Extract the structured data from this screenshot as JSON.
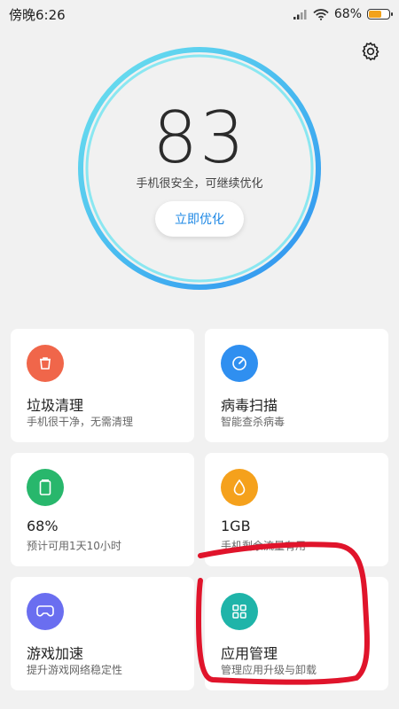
{
  "status_bar": {
    "time": "傍晚6:26",
    "battery_percent": "68%",
    "battery_level": 0.68
  },
  "score": {
    "value": "83",
    "status": "手机很安全，可继续优化",
    "optimize_label": "立即优化"
  },
  "tiles": [
    {
      "title": "垃圾清理",
      "subtitle": "手机很干净，无需清理",
      "icon": "trash-icon",
      "color": "#f0664a"
    },
    {
      "title": "病毒扫描",
      "subtitle": "智能查杀病毒",
      "icon": "scan-gauge-icon",
      "color": "#2f8ff0"
    },
    {
      "title": "68%",
      "subtitle": "预计可用1天10小时",
      "icon": "battery-icon",
      "color": "#28b76c"
    },
    {
      "title": "1GB",
      "subtitle": "手机剩余流量有用",
      "icon": "droplet-icon",
      "color": "#f5a11c"
    },
    {
      "title": "游戏加速",
      "subtitle": "提升游戏网络稳定性",
      "icon": "gamepad-icon",
      "color": "#6a6ef0"
    },
    {
      "title": "应用管理",
      "subtitle": "管理应用升级与卸载",
      "icon": "grid-icon",
      "color": "#1fb4a9"
    }
  ],
  "colors": {
    "ring_outer": "#3aa6ee",
    "ring_inner": "#66dff0",
    "annotation": "#e0142b",
    "accent": "#1e88e5"
  }
}
